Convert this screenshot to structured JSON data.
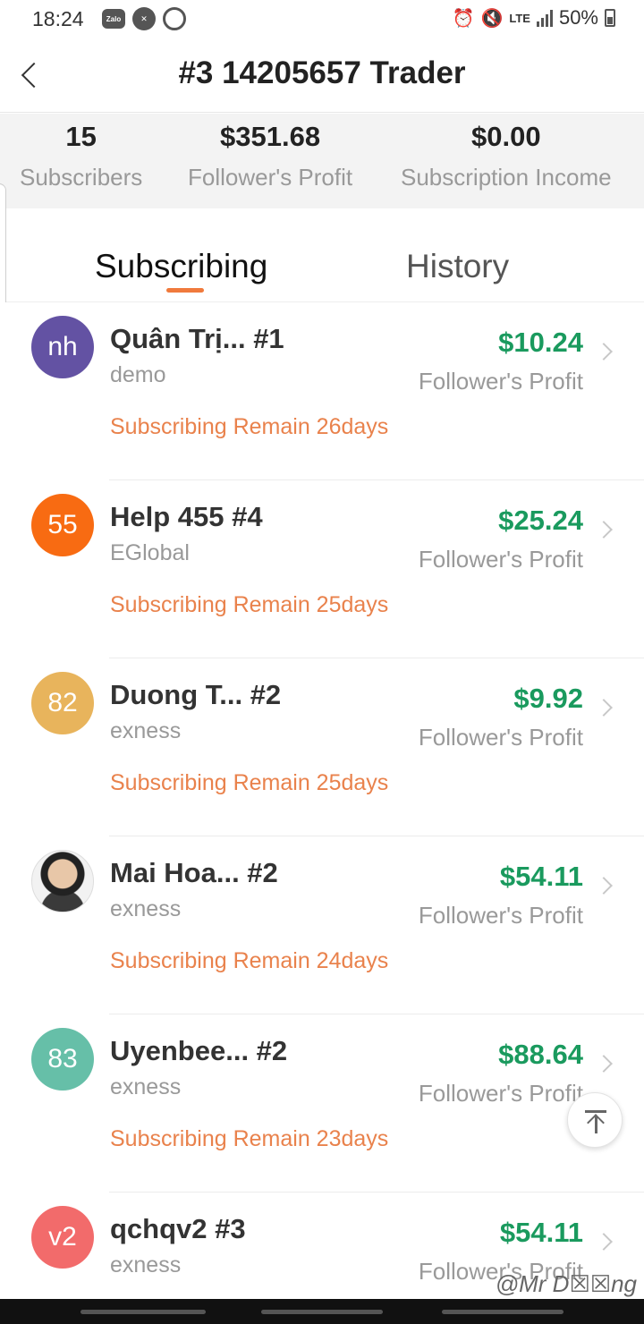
{
  "status_bar": {
    "time": "18:24",
    "left_icons": [
      "zalo-icon",
      "remote-icon",
      "target-icon"
    ],
    "zalo_label": "Zalo",
    "network": "LTE",
    "battery": "50%"
  },
  "header": {
    "title": "#3 14205657 Trader"
  },
  "stats": [
    {
      "value": "15",
      "label": "Subscribers"
    },
    {
      "value": "$351.68",
      "label": "Follower's Profit"
    },
    {
      "value": "$0.00",
      "label": "Subscription Income"
    }
  ],
  "tabs": [
    {
      "label": "Subscribing",
      "active": true
    },
    {
      "label": "History",
      "active": false
    }
  ],
  "subscribers": [
    {
      "avatar_text": "nh",
      "avatar_color": "#6352a3",
      "name": "Quân Trị...  #1",
      "broker": "demo",
      "profit": "$10.24",
      "profit_label": "Follower's Profit",
      "remain": "Subscribing Remain 26days"
    },
    {
      "avatar_text": "55",
      "avatar_color": "#f86b12",
      "name": "Help 455 #4",
      "broker": "EGlobal",
      "profit": "$25.24",
      "profit_label": "Follower's Profit",
      "remain": "Subscribing Remain 25days"
    },
    {
      "avatar_text": "82",
      "avatar_color": "#e8b45c",
      "name": "Duong T...  #2",
      "broker": "exness",
      "profit": "$9.92",
      "profit_label": "Follower's Profit",
      "remain": "Subscribing Remain 25days"
    },
    {
      "avatar_text": "",
      "avatar_color": "#f2f2f2",
      "name": "Mai Hoa...  #2",
      "broker": "exness",
      "profit": "$54.11",
      "profit_label": "Follower's Profit",
      "remain": "Subscribing Remain 24days"
    },
    {
      "avatar_text": "83",
      "avatar_color": "#66bfa8",
      "name": "Uyenbee...  #2",
      "broker": "exness",
      "profit": "$88.64",
      "profit_label": "Follower's Profit",
      "remain": "Subscribing Remain 23days"
    },
    {
      "avatar_text": "v2",
      "avatar_color": "#f26b6b",
      "name": "qchqv2 #3",
      "broker": "exness",
      "profit": "$54.11",
      "profit_label": "Follower's Profit",
      "remain": ""
    }
  ],
  "watermark": "@Mr D☒☒ng",
  "accent_color": "#f07a3c",
  "profit_color": "#1a9a5e"
}
